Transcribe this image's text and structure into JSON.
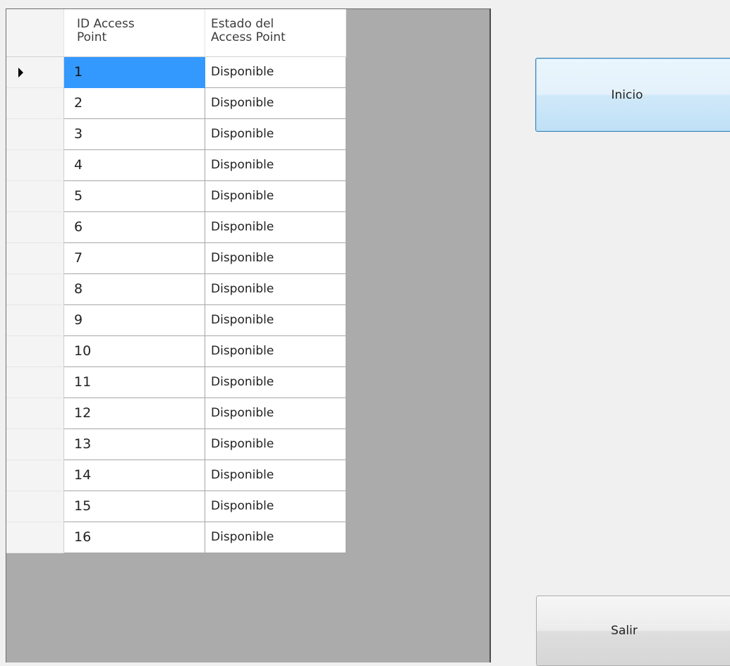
{
  "grid": {
    "headers": [
      "ID Access\nPoint",
      "Estado del\nAccess Point"
    ],
    "current_row_index": 0,
    "rows": [
      {
        "id": "1",
        "estado": "Disponible"
      },
      {
        "id": "2",
        "estado": "Disponible"
      },
      {
        "id": "3",
        "estado": "Disponible"
      },
      {
        "id": "4",
        "estado": "Disponible"
      },
      {
        "id": "5",
        "estado": "Disponible"
      },
      {
        "id": "6",
        "estado": "Disponible"
      },
      {
        "id": "7",
        "estado": "Disponible"
      },
      {
        "id": "8",
        "estado": "Disponible"
      },
      {
        "id": "9",
        "estado": "Disponible"
      },
      {
        "id": "10",
        "estado": "Disponible"
      },
      {
        "id": "11",
        "estado": "Disponible"
      },
      {
        "id": "12",
        "estado": "Disponible"
      },
      {
        "id": "13",
        "estado": "Disponible"
      },
      {
        "id": "14",
        "estado": "Disponible"
      },
      {
        "id": "15",
        "estado": "Disponible"
      },
      {
        "id": "16",
        "estado": "Disponible"
      }
    ]
  },
  "buttons": {
    "inicio": "Inicio",
    "salir": "Salir"
  },
  "colors": {
    "selection": "#3399ff",
    "grid_background": "#ababab",
    "focus_border": "#3c7fb1"
  },
  "icons": {
    "current_row_marker": "current-row-arrow-icon"
  }
}
